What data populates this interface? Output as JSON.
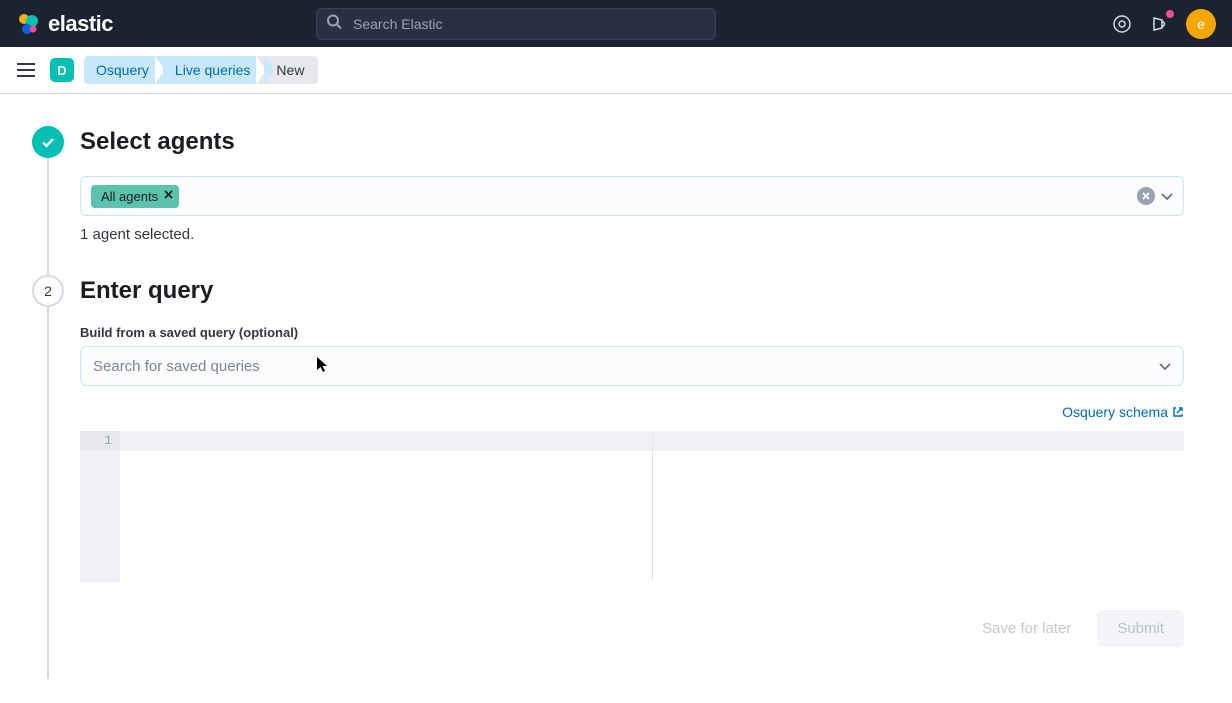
{
  "brand": "elastic",
  "search": {
    "placeholder": "Search Elastic"
  },
  "space_letter": "D",
  "avatar_letter": "e",
  "breadcrumbs": {
    "osquery": "Osquery",
    "live_queries": "Live queries",
    "new": "New"
  },
  "step1": {
    "title": "Select agents",
    "chip": "All agents",
    "count_text": "1 agent selected."
  },
  "step2": {
    "number": "2",
    "title": "Enter query",
    "saved_label": "Build from a saved query (optional)",
    "saved_placeholder": "Search for saved queries",
    "schema_link": "Osquery schema",
    "first_line_no": "1"
  },
  "buttons": {
    "save": "Save for later",
    "submit": "Submit"
  }
}
